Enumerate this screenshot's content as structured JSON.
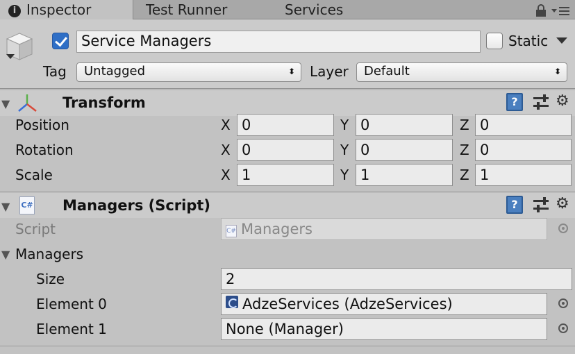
{
  "tabs": [
    {
      "label": "Inspector"
    },
    {
      "label": "Test Runner"
    },
    {
      "label": "Services"
    }
  ],
  "header": {
    "active": true,
    "object_name": "Service Managers",
    "static_label": "Static",
    "static_checked": false,
    "tag_label": "Tag",
    "tag_value": "Untagged",
    "layer_label": "Layer",
    "layer_value": "Default"
  },
  "transform": {
    "title": "Transform",
    "rows": [
      {
        "label": "Position",
        "x": "0",
        "y": "0",
        "z": "0"
      },
      {
        "label": "Rotation",
        "x": "0",
        "y": "0",
        "z": "0"
      },
      {
        "label": "Scale",
        "x": "1",
        "y": "1",
        "z": "1"
      }
    ],
    "axis_x": "X",
    "axis_y": "Y",
    "axis_z": "Z"
  },
  "managers_script": {
    "title": "Managers (Script)",
    "script_label": "Script",
    "script_value": "Managers",
    "cs_glyph": "C#",
    "list_label": "Managers",
    "size_label": "Size",
    "size_value": "2",
    "elements": [
      {
        "label": "Element 0",
        "value": "AdzeServices (AdzeServices)"
      },
      {
        "label": "Element 1",
        "value": "None (Manager)"
      }
    ]
  },
  "icons": {
    "help": "?",
    "gear": "⚙",
    "dropdown_arrow": "▾",
    "select_arrows": "⬍",
    "foldout": "▼"
  },
  "colors": {
    "panel_bg": "#c2c2c2",
    "tab_bg": "#a8a8a8",
    "checkbox_blue": "#2f6fc6",
    "help_blue": "#4a7fbf"
  }
}
